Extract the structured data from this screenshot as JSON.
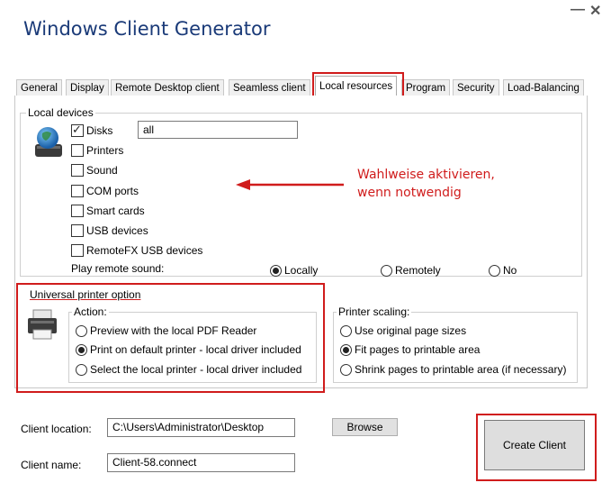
{
  "window": {
    "title": "Windows Client Generator",
    "minimize": "—",
    "close": "✕"
  },
  "tabs": [
    {
      "label": "General"
    },
    {
      "label": "Display"
    },
    {
      "label": "Remote Desktop client"
    },
    {
      "label": "Seamless client"
    },
    {
      "label": "Local resources",
      "active": true
    },
    {
      "label": "Program"
    },
    {
      "label": "Security"
    },
    {
      "label": "Load-Balancing"
    }
  ],
  "local_devices": {
    "legend": "Local devices",
    "disks": {
      "label": "Disks",
      "checked": true,
      "value": "all"
    },
    "items": [
      {
        "label": "Printers",
        "checked": false
      },
      {
        "label": "Sound",
        "checked": false
      },
      {
        "label": "COM ports",
        "checked": false
      },
      {
        "label": "Smart cards",
        "checked": false
      },
      {
        "label": "USB devices",
        "checked": false
      },
      {
        "label": "RemoteFX USB devices",
        "checked": false
      }
    ],
    "play_remote_sound": {
      "label": "Play remote sound:",
      "options": [
        {
          "label": "Locally",
          "selected": true
        },
        {
          "label": "Remotely",
          "selected": false
        },
        {
          "label": "No",
          "selected": false
        }
      ]
    }
  },
  "annotation": {
    "line1": "Wahlweise aktivieren,",
    "line2": "wenn notwendig"
  },
  "printer": {
    "legend": "Universal printer option",
    "action": {
      "legend": "Action:",
      "options": [
        {
          "label": "Preview with the local PDF Reader",
          "selected": false
        },
        {
          "label": "Print on default printer - local driver included",
          "selected": true
        },
        {
          "label": "Select the local printer - local driver included",
          "selected": false
        }
      ]
    },
    "scaling": {
      "legend": "Printer scaling:",
      "options": [
        {
          "label": "Use original page sizes",
          "selected": false
        },
        {
          "label": "Fit pages to printable area",
          "selected": true
        },
        {
          "label": "Shrink pages to printable area (if necessary)",
          "selected": false
        }
      ]
    }
  },
  "footer": {
    "location_label": "Client location:",
    "location_value": "C:\\Users\\Administrator\\Desktop",
    "browse_label": "Browse",
    "name_label": "Client name:",
    "name_value": "Client-58.connect",
    "create_label": "Create Client"
  },
  "colors": {
    "accent_red": "#d01c1c",
    "title_blue": "#1a3a78"
  }
}
